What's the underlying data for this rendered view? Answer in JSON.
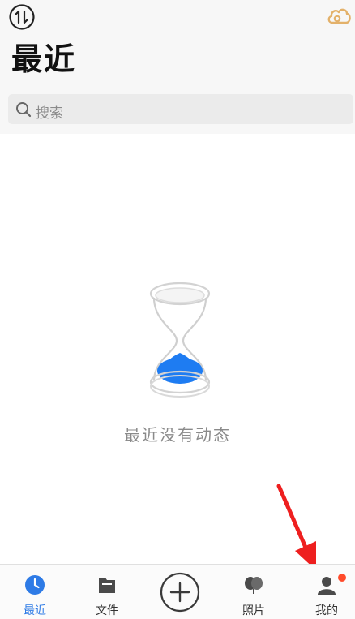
{
  "header": {
    "title": "最近",
    "transfer_icon": "transfer-icon",
    "cloud_icon": "cloud-icon"
  },
  "search": {
    "placeholder": "搜索"
  },
  "empty_state": {
    "illustration": "hourglass-icon",
    "message": "最近没有动态"
  },
  "tabs": [
    {
      "label": "最近",
      "icon": "clock-icon",
      "active": true
    },
    {
      "label": "文件",
      "icon": "folder-icon",
      "active": false
    },
    {
      "label": "",
      "icon": "plus-circle-icon",
      "active": false
    },
    {
      "label": "照片",
      "icon": "photos-icon",
      "active": false
    },
    {
      "label": "我的",
      "icon": "profile-icon",
      "active": false
    }
  ],
  "colors": {
    "accent": "#2e7be6",
    "cloud": "#e3b16a",
    "notification": "#ff4b2b",
    "annotation_arrow": "#ee1f1f"
  }
}
